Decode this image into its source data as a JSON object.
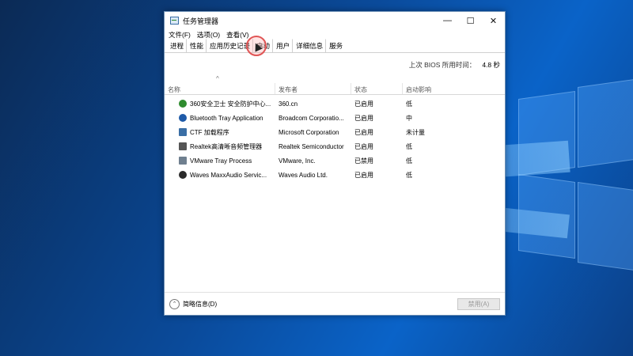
{
  "window": {
    "title": "任务管理器",
    "controls": {
      "minimize": "—",
      "maximize": "☐",
      "close": "✕"
    }
  },
  "menu": [
    "文件(F)",
    "选项(O)",
    "查看(V)"
  ],
  "tabs": [
    "进程",
    "性能",
    "应用历史记录",
    "启动",
    "用户",
    "详细信息",
    "服务"
  ],
  "bios": {
    "label": "上次 BIOS 所用时间：",
    "value": "4.8 秒"
  },
  "columns": [
    "名称",
    "发布者",
    "状态",
    "启动影响"
  ],
  "rows": [
    {
      "name": "360安全卫士 安全防护中心...",
      "publisher": "360.cn",
      "status": "已启用",
      "impact": "低",
      "icon": "360-icon",
      "icon_color": "#2e8b2e"
    },
    {
      "name": "Bluetooth Tray Application",
      "publisher": "Broadcom Corporatio...",
      "status": "已启用",
      "impact": "中",
      "icon": "bluetooth-icon",
      "icon_color": "#1e5aa8"
    },
    {
      "name": "CTF 加载程序",
      "publisher": "Microsoft Corporation",
      "status": "已启用",
      "impact": "未计量",
      "icon": "ctf-loader-icon",
      "icon_color": "#3a6ea5"
    },
    {
      "name": "Realtek高清晰音频管理器",
      "publisher": "Realtek Semiconductor",
      "status": "已启用",
      "impact": "低",
      "icon": "speaker-icon",
      "icon_color": "#555555"
    },
    {
      "name": "VMware Tray Process",
      "publisher": "VMware, Inc.",
      "status": "已禁用",
      "impact": "低",
      "icon": "vmware-icon",
      "icon_color": "#6f7f8f"
    },
    {
      "name": "Waves MaxxAudio Servic...",
      "publisher": "Waves Audio Ltd.",
      "status": "已启用",
      "impact": "低",
      "icon": "waves-icon",
      "icon_color": "#2a2a2a"
    }
  ],
  "footer": {
    "collapse_label": "简略信息(D)",
    "disable_label": "禁用(A)"
  }
}
